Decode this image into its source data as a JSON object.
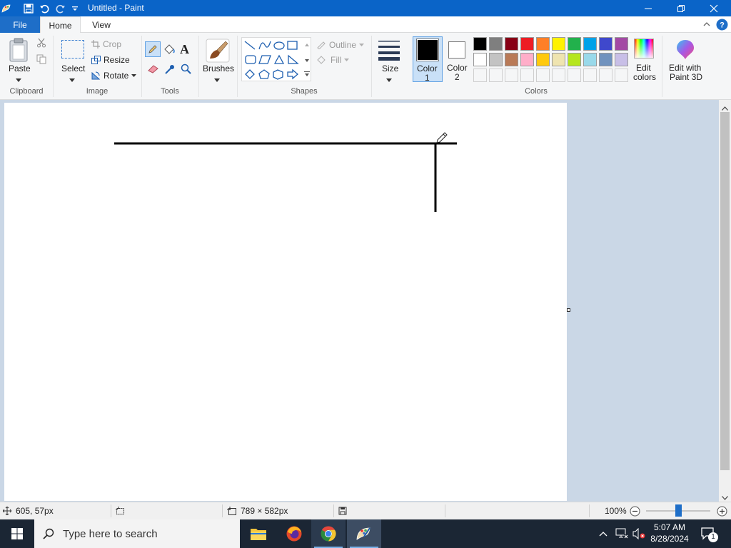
{
  "window": {
    "title": "Untitled - Paint"
  },
  "tabs": {
    "file": "File",
    "home": "Home",
    "view": "View"
  },
  "clipboard": {
    "paste": "Paste",
    "group": "Clipboard"
  },
  "image": {
    "select": "Select",
    "crop": "Crop",
    "resize": "Resize",
    "rotate": "Rotate",
    "group": "Image"
  },
  "tools": {
    "group": "Tools"
  },
  "brushes": {
    "label": "Brushes"
  },
  "shapes": {
    "outline": "Outline",
    "fill": "Fill",
    "group": "Shapes"
  },
  "size": {
    "label": "Size"
  },
  "color1": {
    "line1": "Color",
    "line2": "1",
    "value": "#000000"
  },
  "color2": {
    "line1": "Color",
    "line2": "2",
    "value": "#ffffff"
  },
  "colors": {
    "group": "Colors",
    "row1": [
      "#000000",
      "#7f7f7f",
      "#880015",
      "#ed1c24",
      "#ff7f27",
      "#fff200",
      "#22b14c",
      "#00a2e8",
      "#3f48cc",
      "#a349a4"
    ],
    "row2": [
      "#ffffff",
      "#c3c3c3",
      "#b97a57",
      "#ffaec9",
      "#ffc90e",
      "#efe4b0",
      "#b5e61d",
      "#99d9ea",
      "#7092be",
      "#c8bfe7"
    ]
  },
  "edit_colors": {
    "line1": "Edit",
    "line2": "colors"
  },
  "paint3d": {
    "line1": "Edit with",
    "line2": "Paint 3D"
  },
  "status": {
    "cursor_pos": "605, 57px",
    "canvas_size": "789 × 582px",
    "zoom": "100%",
    "zoom_slider_fraction": 0.5
  },
  "taskbar": {
    "search_placeholder": "Type here to search",
    "time": "5:07 AM",
    "date": "8/28/2024",
    "notification_count": "1"
  }
}
